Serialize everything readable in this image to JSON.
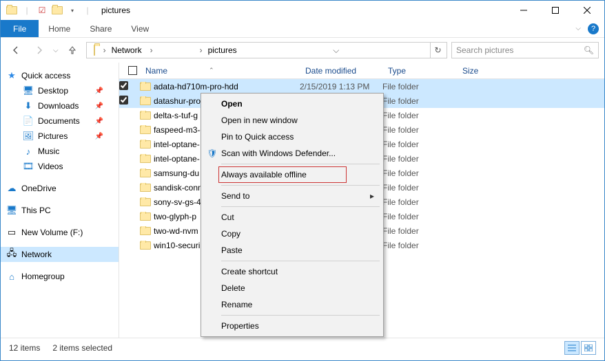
{
  "window": {
    "title": "pictures"
  },
  "ribbon": {
    "file": "File",
    "tabs": [
      "Home",
      "Share",
      "View"
    ]
  },
  "address": {
    "crumbs": [
      "Network",
      "",
      "pictures"
    ]
  },
  "search": {
    "placeholder": "Search pictures"
  },
  "sidebar": {
    "quickaccess": {
      "label": "Quick access",
      "items": [
        {
          "label": "Desktop",
          "pinned": true
        },
        {
          "label": "Downloads",
          "pinned": true
        },
        {
          "label": "Documents",
          "pinned": true
        },
        {
          "label": "Pictures",
          "pinned": true
        },
        {
          "label": "Music",
          "pinned": false
        },
        {
          "label": "Videos",
          "pinned": false
        }
      ]
    },
    "onedrive": "OneDrive",
    "thispc": "This PC",
    "volume": "New Volume (F:)",
    "network": "Network",
    "homegroup": "Homegroup"
  },
  "columns": {
    "name": "Name",
    "date": "Date modified",
    "type": "Type",
    "size": "Size"
  },
  "files": [
    {
      "name": "adata-hd710m-pro-hdd",
      "date": "2/15/2019 1:13 PM",
      "type": "File folder",
      "selected": true
    },
    {
      "name": "datashur-pro",
      "date": "",
      "type": "File folder",
      "selected": true
    },
    {
      "name": "delta-s-tuf-g",
      "date": "",
      "type": "File folder",
      "selected": false
    },
    {
      "name": "faspeed-m3-e",
      "date": "",
      "type": "File folder",
      "selected": false
    },
    {
      "name": "intel-optane-",
      "date": "",
      "type": "File folder",
      "selected": false
    },
    {
      "name": "intel-optane-",
      "date": "",
      "type": "File folder",
      "selected": false
    },
    {
      "name": "samsung-du",
      "date": "",
      "type": "File folder",
      "selected": false
    },
    {
      "name": "sandisk-conn",
      "date": "",
      "type": "File folder",
      "selected": false
    },
    {
      "name": "sony-sv-gs-4",
      "date": "",
      "type": "File folder",
      "selected": false
    },
    {
      "name": "two-glyph-p",
      "date": "",
      "type": "File folder",
      "selected": false
    },
    {
      "name": "two-wd-nvm",
      "date": "",
      "type": "File folder",
      "selected": false
    },
    {
      "name": "win10-securi",
      "date": "",
      "type": "File folder",
      "selected": false
    }
  ],
  "context": {
    "items": [
      {
        "label": "Open",
        "bold": true
      },
      {
        "label": "Open in new window"
      },
      {
        "label": "Pin to Quick access"
      },
      {
        "label": "Scan with Windows Defender...",
        "icon": "defender"
      },
      {
        "sep": true
      },
      {
        "label": "Always available offline",
        "highlight": true
      },
      {
        "sep": true
      },
      {
        "label": "Send to",
        "submenu": true
      },
      {
        "sep": true
      },
      {
        "label": "Cut"
      },
      {
        "label": "Copy"
      },
      {
        "label": "Paste"
      },
      {
        "sep": true
      },
      {
        "label": "Create shortcut"
      },
      {
        "label": "Delete"
      },
      {
        "label": "Rename"
      },
      {
        "sep": true
      },
      {
        "label": "Properties"
      }
    ]
  },
  "status": {
    "count": "12 items",
    "selected": "2 items selected"
  }
}
